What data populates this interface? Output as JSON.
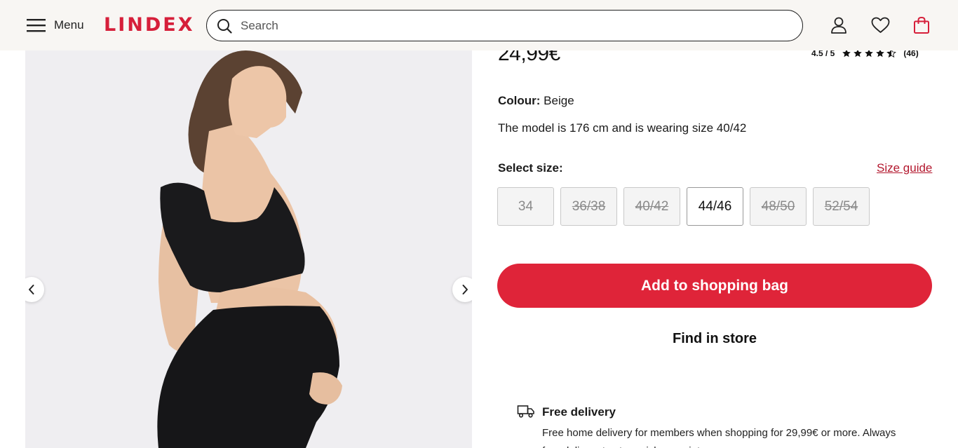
{
  "header": {
    "menu_label": "Menu",
    "logo": "LINDEX",
    "search_placeholder": "Search",
    "brand_color": "#d61f3a"
  },
  "product": {
    "price": "24,99€",
    "rating": {
      "score_text": "4.5 / 5",
      "value": 4.5,
      "max": 5,
      "count_text": "(46)"
    },
    "colour_label": "Colour:",
    "colour_value": "Beige",
    "model_info": "The model is 176 cm and is wearing size 40/42",
    "select_size_label": "Select size:",
    "size_guide_label": "Size guide",
    "sizes": [
      {
        "label": "34",
        "available": false
      },
      {
        "label": "36/38",
        "available": false
      },
      {
        "label": "40/42",
        "available": false
      },
      {
        "label": "44/46",
        "available": true
      },
      {
        "label": "48/50",
        "available": false
      },
      {
        "label": "52/54",
        "available": false
      }
    ],
    "add_to_bag_label": "Add to shopping bag",
    "find_in_store_label": "Find in store",
    "accent_color": "#df2439"
  },
  "delivery": {
    "title": "Free delivery",
    "text": "Free home delivery for members when shopping for 29,99€ or more. Always free delivery to store pick-up point."
  },
  "icons": {
    "menu": "hamburger-icon",
    "search": "search-icon",
    "account": "user-icon",
    "favourites": "heart-icon",
    "bag": "shopping-bag-icon",
    "prev": "chevron-left-icon",
    "next": "chevron-right-icon",
    "delivery": "truck-icon",
    "rating": "star-icon"
  }
}
